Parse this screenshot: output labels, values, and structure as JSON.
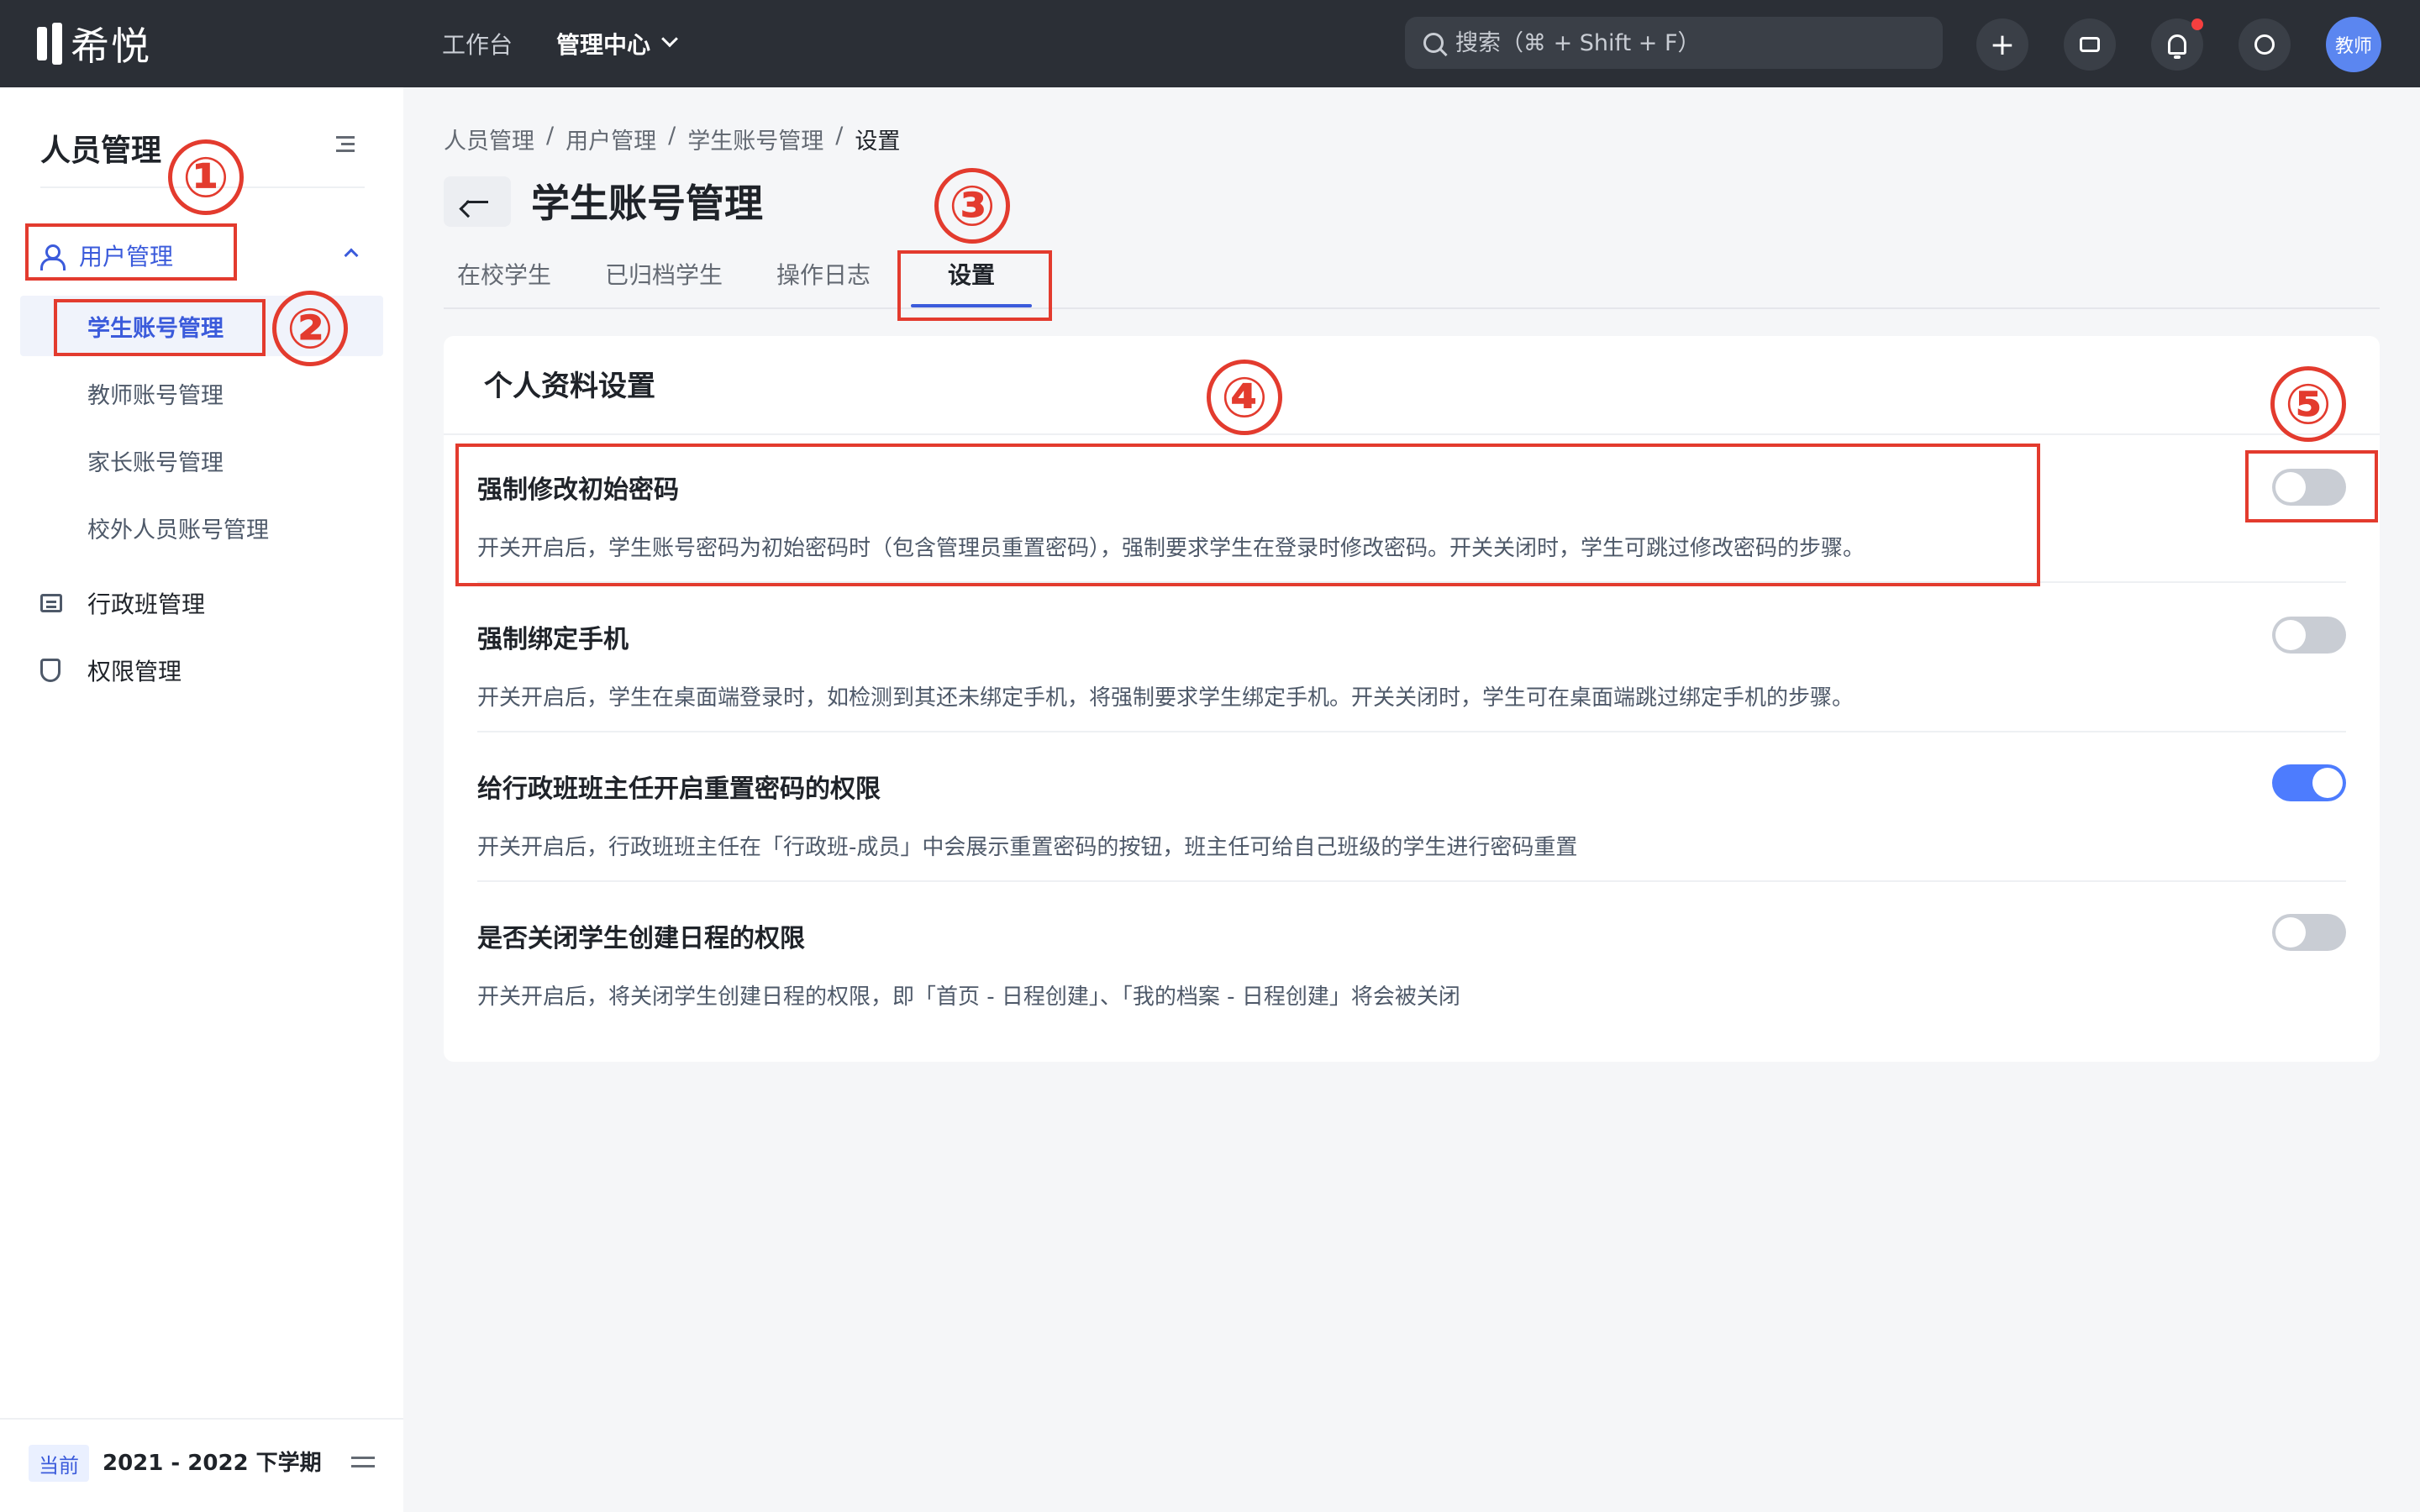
{
  "app": {
    "brand": "希悦"
  },
  "topbar": {
    "nav": [
      {
        "label": "工作台"
      },
      {
        "label": "管理中心"
      }
    ],
    "search_placeholder": "搜索（⌘ + Shift + F）",
    "plus_label": "+",
    "avatar_label": "教师",
    "colors": {
      "bg": "#2b2f36",
      "notification_dot": "#f53f3f",
      "avatar": "#5b86f0"
    }
  },
  "sidebar": {
    "title": "人员管理",
    "group": {
      "label": "用户管理",
      "items": [
        {
          "label": "学生账号管理",
          "active": true
        },
        {
          "label": "教师账号管理"
        },
        {
          "label": "家长账号管理"
        },
        {
          "label": "校外人员账号管理"
        }
      ]
    },
    "items": [
      {
        "label": "行政班管理"
      },
      {
        "label": "权限管理"
      }
    ],
    "footer": {
      "badge": "当前",
      "term": "2021 - 2022 下学期"
    }
  },
  "main": {
    "breadcrumb": [
      "人员管理",
      "用户管理",
      "学生账号管理",
      "设置"
    ],
    "breadcrumb_sep": "/",
    "title": "学生账号管理",
    "tabs": [
      {
        "label": "在校学生"
      },
      {
        "label": "已归档学生"
      },
      {
        "label": "操作日志"
      },
      {
        "label": "设置",
        "active": true
      }
    ],
    "card": {
      "title": "个人资料设置",
      "settings": [
        {
          "title": "强制修改初始密码",
          "desc": "开关开启后，学生账号密码为初始密码时（包含管理员重置密码），强制要求学生在登录时修改密码。开关关闭时，学生可跳过修改密码的步骤。",
          "enabled": false
        },
        {
          "title": "强制绑定手机",
          "desc": "开关开启后，学生在桌面端登录时，如检测到其还未绑定手机，将强制要求学生绑定手机。开关关闭时，学生可在桌面端跳过绑定手机的步骤。",
          "enabled": false
        },
        {
          "title": "给行政班班主任开启重置密码的权限",
          "desc": "开关开启后，行政班班主任在「行政班-成员」中会展示重置密码的按钮，班主任可给自己班级的学生进行密码重置",
          "enabled": true
        },
        {
          "title": "是否关闭学生创建日程的权限",
          "desc": "开关开启后，将关闭学生创建日程的权限，即「首页 - 日程创建」、「我的档案 - 日程创建」将会被关闭",
          "enabled": false
        }
      ]
    }
  },
  "annotations": [
    "①",
    "②",
    "③",
    "④",
    "⑤"
  ],
  "colors": {
    "accent": "#3b5bdb",
    "toggle_on": "#4d7cfe",
    "toggle_off": "#c9cdd4",
    "annotation": "#e33b2e"
  }
}
